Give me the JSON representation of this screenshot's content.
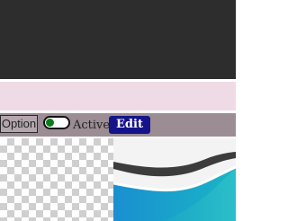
{
  "toolbar": {
    "option_label": "Option",
    "toggle": {
      "label": "Active",
      "on": true
    },
    "edit_label": "Edit"
  },
  "colors": {
    "top_bar": "#2d2d2d",
    "band": "#efdbe6",
    "toolbar_bg": "#9b8d93",
    "toggle_on": "#0a7d1a",
    "edit_button": "#15138a"
  },
  "images": {
    "transparent_placeholder": "checkerboard-pattern",
    "wave_graphic": "blue-teal-wave-logo"
  }
}
